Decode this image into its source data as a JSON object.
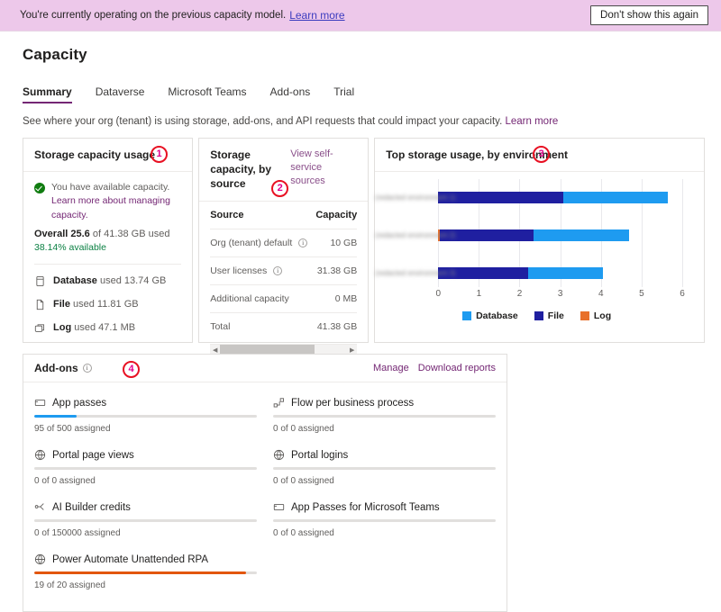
{
  "banner": {
    "text": "You're currently operating on the previous capacity model.",
    "link": "Learn more",
    "dismiss": "Don't show this again"
  },
  "header": {
    "title": "Capacity",
    "subtitle": "See where your org (tenant) is using storage, add-ons, and API requests that could impact your capacity.",
    "subtitle_link": "Learn more",
    "tabs": [
      {
        "label": "Summary",
        "active": true
      },
      {
        "label": "Dataverse",
        "active": false
      },
      {
        "label": "Microsoft Teams",
        "active": false
      },
      {
        "label": "Add-ons",
        "active": false
      },
      {
        "label": "Trial",
        "active": false
      }
    ]
  },
  "usage_card": {
    "title": "Storage capacity usage",
    "marker": "1",
    "status_message": "You have available capacity.",
    "status_link": "Learn more about managing capacity.",
    "overall_label": "Overall",
    "overall_value": "25.6",
    "overall_rest": "of 41.38 GB used",
    "available": "38.14% available",
    "breakdown": [
      {
        "icon": "database-icon",
        "name": "Database",
        "value": "used 13.74 GB"
      },
      {
        "icon": "file-icon",
        "name": "File",
        "value": "used 11.81 GB"
      },
      {
        "icon": "log-icon",
        "name": "Log",
        "value": "used 47.1 MB"
      }
    ]
  },
  "source_card": {
    "title": "Storage capacity, by source",
    "marker": "2",
    "link": "View self-service sources",
    "columns": [
      "Source",
      "Capacity"
    ],
    "rows": [
      {
        "source": "Org (tenant) default",
        "info": true,
        "capacity": "10 GB"
      },
      {
        "source": "User licenses",
        "info": true,
        "capacity": "31.38 GB"
      },
      {
        "source": "Additional capacity",
        "info": false,
        "capacity": "0 MB"
      },
      {
        "source": "Total",
        "info": false,
        "capacity": "41.38 GB"
      }
    ]
  },
  "chart_card": {
    "title": "Top storage usage, by environment",
    "marker": "3"
  },
  "chart_data": {
    "type": "bar",
    "orientation": "horizontal",
    "stacked": true,
    "title": "Top storage usage, by environment",
    "xlabel": "",
    "ylabel": "",
    "xlim": [
      0,
      6
    ],
    "xticks": [
      0,
      1,
      2,
      3,
      4,
      5,
      6
    ],
    "grid": true,
    "legend_position": "bottom",
    "categories": [
      "(redacted environment 1)",
      "(redacted environment 2)",
      "(redacted environment 3)"
    ],
    "series": [
      {
        "name": "Database",
        "color": "#1e9bf0",
        "values": [
          2.58,
          2.35,
          1.82
        ]
      },
      {
        "name": "File",
        "color": "#1f1fa0",
        "values": [
          3.07,
          2.32,
          2.22
        ]
      },
      {
        "name": "Log",
        "color": "#e8702a",
        "values": [
          0.0,
          0.03,
          0.0
        ]
      }
    ],
    "totals": [
      5.65,
      4.7,
      4.04
    ],
    "stack_order": [
      "Log",
      "File",
      "Database"
    ]
  },
  "addons_card": {
    "title": "Add-ons",
    "marker": "4",
    "actions": [
      "Manage",
      "Download reports"
    ],
    "items": [
      {
        "icon": "app-passes-icon",
        "name": "App passes",
        "assigned": 95,
        "total": 500,
        "sub": "95 of 500 assigned",
        "color": "#1e9bf0",
        "percent": 19
      },
      {
        "icon": "flow-icon",
        "name": "Flow per business process",
        "assigned": 0,
        "total": 0,
        "sub": "0 of 0 assigned",
        "color": "#1e9bf0",
        "percent": 0
      },
      {
        "icon": "globe-icon",
        "name": "Portal page views",
        "assigned": 0,
        "total": 0,
        "sub": "0 of 0 assigned",
        "color": "#1e9bf0",
        "percent": 0
      },
      {
        "icon": "globe-icon",
        "name": "Portal logins",
        "assigned": 0,
        "total": 0,
        "sub": "0 of 0 assigned",
        "color": "#1e9bf0",
        "percent": 0
      },
      {
        "icon": "ai-builder-icon",
        "name": "AI Builder credits",
        "assigned": 0,
        "total": 150000,
        "sub": "0 of 150000 assigned",
        "color": "#1e9bf0",
        "percent": 0
      },
      {
        "icon": "app-passes-icon",
        "name": "App Passes for Microsoft Teams",
        "assigned": 0,
        "total": 0,
        "sub": "0 of 0 assigned",
        "color": "#1e9bf0",
        "percent": 0
      },
      {
        "icon": "globe-icon",
        "name": "Power Automate Unattended RPA",
        "assigned": 19,
        "total": 20,
        "sub": "19 of 20 assigned",
        "color": "#e2560f",
        "percent": 95
      }
    ]
  },
  "colors": {
    "banner_bg": "#edc8ea",
    "accent": "#742774",
    "database": "#1e9bf0",
    "file": "#1f1fa0",
    "log": "#e8702a",
    "success": "#107c10",
    "marker_ring": "#e81123",
    "marker_text": "#e3008c"
  }
}
